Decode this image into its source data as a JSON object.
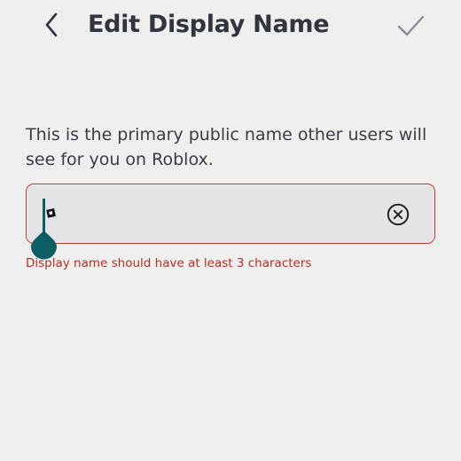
{
  "header": {
    "back_icon": "chevron-left-icon",
    "title": "Edit Display Name",
    "confirm_icon": "checkmark-icon"
  },
  "description": "This is the primary public name other users will see for you on Roblox.",
  "display_name_input": {
    "value": "",
    "placeholder": "",
    "clear_icon": "clear-circle-x-icon"
  },
  "error_message": "Display name should have at least 3 characters",
  "colors": {
    "background": "#efeff0",
    "text": "#393c42",
    "error": "#b5301f",
    "input_border_error": "#c93a30",
    "caret_handle": "#0b5e63"
  }
}
